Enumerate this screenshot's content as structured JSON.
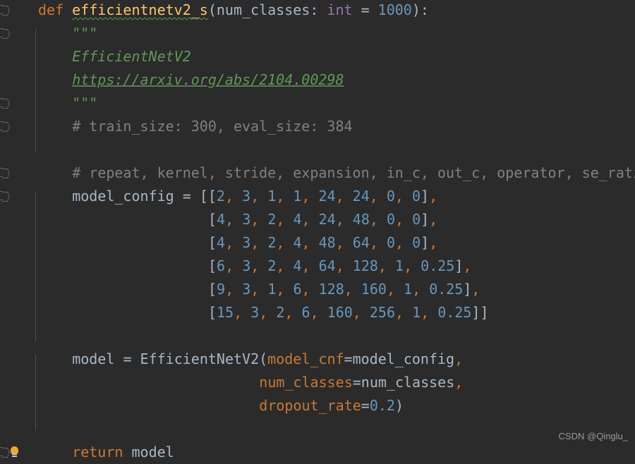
{
  "editor": {
    "theme": "darcula",
    "background_color": "#2b2b2b",
    "gutter_color": "#2b2b2b",
    "indent_guide_color": "#4b4f51",
    "language": "python"
  },
  "gutter": {
    "fold_marker_name": "code-fold-marker",
    "bulb_tooltip": "Show Context Actions"
  },
  "code": {
    "lines": [
      {
        "id": "line-1",
        "tokens": [
          {
            "text": "def ",
            "cls": "kw"
          },
          {
            "text": "efficientnetv2_s",
            "cls": "fname spell"
          },
          {
            "text": "(",
            "cls": "punc"
          },
          {
            "text": "num_classes",
            "cls": "param"
          },
          {
            "text": ": ",
            "cls": "punc"
          },
          {
            "text": "int",
            "cls": "type"
          },
          {
            "text": " = ",
            "cls": "op"
          },
          {
            "text": "1000",
            "cls": "num"
          },
          {
            "text": "):",
            "cls": "punc"
          }
        ]
      },
      {
        "id": "line-2",
        "indent": 4,
        "tokens": [
          {
            "text": "\"\"\"",
            "cls": "doc"
          }
        ]
      },
      {
        "id": "line-3",
        "indent": 4,
        "tokens": [
          {
            "text": "EfficientNetV2",
            "cls": "doc"
          }
        ]
      },
      {
        "id": "line-4",
        "indent": 4,
        "tokens": [
          {
            "text": "https://arxiv.org/abs/2104.00298",
            "cls": "doclink"
          }
        ]
      },
      {
        "id": "line-5",
        "indent": 4,
        "tokens": [
          {
            "text": "\"\"\"",
            "cls": "doc"
          }
        ]
      },
      {
        "id": "line-6",
        "indent": 4,
        "tokens": [
          {
            "text": "# train_size: 300, eval_size: 384",
            "cls": "comment"
          }
        ]
      },
      {
        "id": "line-7",
        "indent": 4,
        "tokens": []
      },
      {
        "id": "line-8",
        "indent": 4,
        "tokens": [
          {
            "text": "# repeat, kernel, stride, expansion, in_c, out_c, operator, se_ratio",
            "cls": "comment"
          }
        ]
      },
      {
        "id": "line-9",
        "indent": 4,
        "tokens": [
          {
            "text": "model_config",
            "cls": "ident"
          },
          {
            "text": " = ",
            "cls": "op"
          },
          {
            "text": "[[",
            "cls": "punc"
          },
          {
            "text": "2",
            "cls": "num"
          },
          {
            "text": ", ",
            "cls": "comma"
          },
          {
            "text": "3",
            "cls": "num"
          },
          {
            "text": ", ",
            "cls": "comma"
          },
          {
            "text": "1",
            "cls": "num"
          },
          {
            "text": ", ",
            "cls": "comma"
          },
          {
            "text": "1",
            "cls": "num"
          },
          {
            "text": ", ",
            "cls": "comma"
          },
          {
            "text": "24",
            "cls": "num"
          },
          {
            "text": ", ",
            "cls": "comma"
          },
          {
            "text": "24",
            "cls": "num"
          },
          {
            "text": ", ",
            "cls": "comma"
          },
          {
            "text": "0",
            "cls": "num"
          },
          {
            "text": ", ",
            "cls": "comma"
          },
          {
            "text": "0",
            "cls": "num"
          },
          {
            "text": "]",
            "cls": "punc"
          },
          {
            "text": ",",
            "cls": "comma"
          }
        ]
      },
      {
        "id": "line-10",
        "indent": 20,
        "tokens": [
          {
            "text": "[",
            "cls": "punc"
          },
          {
            "text": "4",
            "cls": "num"
          },
          {
            "text": ", ",
            "cls": "comma"
          },
          {
            "text": "3",
            "cls": "num"
          },
          {
            "text": ", ",
            "cls": "comma"
          },
          {
            "text": "2",
            "cls": "num"
          },
          {
            "text": ", ",
            "cls": "comma"
          },
          {
            "text": "4",
            "cls": "num"
          },
          {
            "text": ", ",
            "cls": "comma"
          },
          {
            "text": "24",
            "cls": "num"
          },
          {
            "text": ", ",
            "cls": "comma"
          },
          {
            "text": "48",
            "cls": "num"
          },
          {
            "text": ", ",
            "cls": "comma"
          },
          {
            "text": "0",
            "cls": "num"
          },
          {
            "text": ", ",
            "cls": "comma"
          },
          {
            "text": "0",
            "cls": "num"
          },
          {
            "text": "]",
            "cls": "punc"
          },
          {
            "text": ",",
            "cls": "comma"
          }
        ]
      },
      {
        "id": "line-11",
        "indent": 20,
        "tokens": [
          {
            "text": "[",
            "cls": "punc"
          },
          {
            "text": "4",
            "cls": "num"
          },
          {
            "text": ", ",
            "cls": "comma"
          },
          {
            "text": "3",
            "cls": "num"
          },
          {
            "text": ", ",
            "cls": "comma"
          },
          {
            "text": "2",
            "cls": "num"
          },
          {
            "text": ", ",
            "cls": "comma"
          },
          {
            "text": "4",
            "cls": "num"
          },
          {
            "text": ", ",
            "cls": "comma"
          },
          {
            "text": "48",
            "cls": "num"
          },
          {
            "text": ", ",
            "cls": "comma"
          },
          {
            "text": "64",
            "cls": "num"
          },
          {
            "text": ", ",
            "cls": "comma"
          },
          {
            "text": "0",
            "cls": "num"
          },
          {
            "text": ", ",
            "cls": "comma"
          },
          {
            "text": "0",
            "cls": "num"
          },
          {
            "text": "]",
            "cls": "punc"
          },
          {
            "text": ",",
            "cls": "comma"
          }
        ]
      },
      {
        "id": "line-12",
        "indent": 20,
        "tokens": [
          {
            "text": "[",
            "cls": "punc"
          },
          {
            "text": "6",
            "cls": "num"
          },
          {
            "text": ", ",
            "cls": "comma"
          },
          {
            "text": "3",
            "cls": "num"
          },
          {
            "text": ", ",
            "cls": "comma"
          },
          {
            "text": "2",
            "cls": "num"
          },
          {
            "text": ", ",
            "cls": "comma"
          },
          {
            "text": "4",
            "cls": "num"
          },
          {
            "text": ", ",
            "cls": "comma"
          },
          {
            "text": "64",
            "cls": "num"
          },
          {
            "text": ", ",
            "cls": "comma"
          },
          {
            "text": "128",
            "cls": "num"
          },
          {
            "text": ", ",
            "cls": "comma"
          },
          {
            "text": "1",
            "cls": "num"
          },
          {
            "text": ", ",
            "cls": "comma"
          },
          {
            "text": "0.25",
            "cls": "num"
          },
          {
            "text": "]",
            "cls": "punc"
          },
          {
            "text": ",",
            "cls": "comma"
          }
        ]
      },
      {
        "id": "line-13",
        "indent": 20,
        "tokens": [
          {
            "text": "[",
            "cls": "punc"
          },
          {
            "text": "9",
            "cls": "num"
          },
          {
            "text": ", ",
            "cls": "comma"
          },
          {
            "text": "3",
            "cls": "num"
          },
          {
            "text": ", ",
            "cls": "comma"
          },
          {
            "text": "1",
            "cls": "num"
          },
          {
            "text": ", ",
            "cls": "comma"
          },
          {
            "text": "6",
            "cls": "num"
          },
          {
            "text": ", ",
            "cls": "comma"
          },
          {
            "text": "128",
            "cls": "num"
          },
          {
            "text": ", ",
            "cls": "comma"
          },
          {
            "text": "160",
            "cls": "num"
          },
          {
            "text": ", ",
            "cls": "comma"
          },
          {
            "text": "1",
            "cls": "num"
          },
          {
            "text": ", ",
            "cls": "comma"
          },
          {
            "text": "0.25",
            "cls": "num"
          },
          {
            "text": "]",
            "cls": "punc"
          },
          {
            "text": ",",
            "cls": "comma"
          }
        ]
      },
      {
        "id": "line-14",
        "indent": 20,
        "tokens": [
          {
            "text": "[",
            "cls": "punc"
          },
          {
            "text": "15",
            "cls": "num"
          },
          {
            "text": ", ",
            "cls": "comma"
          },
          {
            "text": "3",
            "cls": "num"
          },
          {
            "text": ", ",
            "cls": "comma"
          },
          {
            "text": "2",
            "cls": "num"
          },
          {
            "text": ", ",
            "cls": "comma"
          },
          {
            "text": "6",
            "cls": "num"
          },
          {
            "text": ", ",
            "cls": "comma"
          },
          {
            "text": "160",
            "cls": "num"
          },
          {
            "text": ", ",
            "cls": "comma"
          },
          {
            "text": "256",
            "cls": "num"
          },
          {
            "text": ", ",
            "cls": "comma"
          },
          {
            "text": "1",
            "cls": "num"
          },
          {
            "text": ", ",
            "cls": "comma"
          },
          {
            "text": "0.25",
            "cls": "num"
          },
          {
            "text": "]]",
            "cls": "punc"
          }
        ]
      },
      {
        "id": "line-15",
        "indent": 4,
        "tokens": []
      },
      {
        "id": "line-16",
        "indent": 4,
        "tokens": [
          {
            "text": "model",
            "cls": "ident"
          },
          {
            "text": " = ",
            "cls": "op"
          },
          {
            "text": "EfficientNetV2",
            "cls": "cls"
          },
          {
            "text": "(",
            "cls": "punc"
          },
          {
            "text": "model_cnf",
            "cls": "kwarg"
          },
          {
            "text": "=",
            "cls": "punc"
          },
          {
            "text": "model_config",
            "cls": "ident"
          },
          {
            "text": ",",
            "cls": "comma"
          }
        ]
      },
      {
        "id": "line-17",
        "indent": 26,
        "tokens": [
          {
            "text": "num_classes",
            "cls": "kwarg"
          },
          {
            "text": "=",
            "cls": "punc"
          },
          {
            "text": "num_classes",
            "cls": "ident"
          },
          {
            "text": ",",
            "cls": "comma"
          }
        ]
      },
      {
        "id": "line-18",
        "indent": 26,
        "tokens": [
          {
            "text": "dropout_rate",
            "cls": "kwarg"
          },
          {
            "text": "=",
            "cls": "punc"
          },
          {
            "text": "0.2",
            "cls": "num"
          },
          {
            "text": ")",
            "cls": "punc"
          }
        ]
      },
      {
        "id": "line-19",
        "indent": 4,
        "tokens": []
      },
      {
        "id": "line-20",
        "indent": 4,
        "tokens": [
          {
            "text": "return ",
            "cls": "kw"
          },
          {
            "text": "model",
            "cls": "ident"
          }
        ]
      }
    ]
  },
  "watermark": {
    "text": "CSDN @Qinglu_"
  }
}
